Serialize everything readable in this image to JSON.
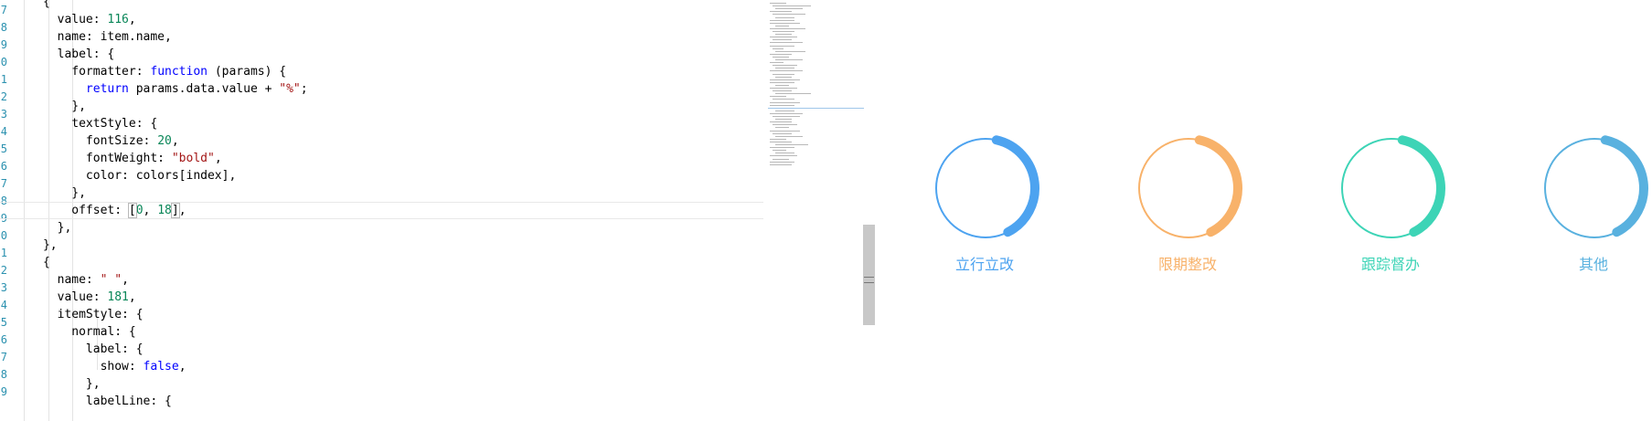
{
  "editor": {
    "gutter_numbers": [
      "7",
      "8",
      "9",
      "0",
      "1",
      "2",
      "3",
      "4",
      "5",
      "6",
      "7",
      "8",
      "9",
      "0",
      "1",
      "2",
      "3",
      "4",
      "5",
      "6",
      "7",
      "8",
      "9"
    ],
    "current_line_index": 12,
    "lines": [
      [
        {
          "t": "      {"
        }
      ],
      [
        {
          "t": "        value: "
        },
        {
          "t": "116",
          "c": "num"
        },
        {
          "t": ","
        }
      ],
      [
        {
          "t": "        name: item.name,"
        }
      ],
      [
        {
          "t": "        label: {"
        }
      ],
      [
        {
          "t": "          formatter: "
        },
        {
          "t": "function",
          "c": "kw"
        },
        {
          "t": " (params) {"
        }
      ],
      [
        {
          "t": "            "
        },
        {
          "t": "return",
          "c": "kw"
        },
        {
          "t": " params.data.value + "
        },
        {
          "t": "\"%\"",
          "c": "str"
        },
        {
          "t": ";"
        }
      ],
      [
        {
          "t": "          },"
        }
      ],
      [
        {
          "t": "          textStyle: {"
        }
      ],
      [
        {
          "t": "            fontSize: "
        },
        {
          "t": "20",
          "c": "num"
        },
        {
          "t": ","
        }
      ],
      [
        {
          "t": "            fontWeight: "
        },
        {
          "t": "\"bold\"",
          "c": "str"
        },
        {
          "t": ","
        }
      ],
      [
        {
          "t": "            color: colors[index],"
        }
      ],
      [
        {
          "t": "          },"
        }
      ],
      [
        {
          "t": "          offset: "
        },
        {
          "t": "[",
          "c": "caret"
        },
        {
          "t": "0",
          "c": "num"
        },
        {
          "t": ", "
        },
        {
          "t": "18",
          "c": "num"
        },
        {
          "t": "]",
          "c": "caret"
        },
        {
          "t": ","
        }
      ],
      [
        {
          "t": "        },"
        }
      ],
      [
        {
          "t": "      },"
        }
      ],
      [
        {
          "t": "      {"
        }
      ],
      [
        {
          "t": "        name: "
        },
        {
          "t": "\" \"",
          "c": "str"
        },
        {
          "t": ","
        }
      ],
      [
        {
          "t": "        value: "
        },
        {
          "t": "181",
          "c": "num"
        },
        {
          "t": ","
        }
      ],
      [
        {
          "t": "        itemStyle: {"
        }
      ],
      [
        {
          "t": "          normal: {"
        }
      ],
      [
        {
          "t": "            label: {"
        }
      ],
      [
        {
          "t": "              show: "
        },
        {
          "t": "false",
          "c": "kw"
        },
        {
          "t": ","
        }
      ],
      [
        {
          "t": "            },"
        }
      ],
      [
        {
          "t": "            labelLine: {"
        }
      ]
    ]
  },
  "gauges": [
    {
      "label": "立行立改",
      "color": "#4da3f0",
      "value": 116,
      "remainder": 181
    },
    {
      "label": "限期整改",
      "color": "#f8b26a",
      "value": 116,
      "remainder": 181
    },
    {
      "label": "跟踪督办",
      "color": "#3dd4b6",
      "value": 116,
      "remainder": 181
    },
    {
      "label": "其他",
      "color": "#59b1df",
      "value": 116,
      "remainder": 181
    }
  ],
  "colors": {
    "num": "#098658",
    "str": "#a31515",
    "kw": "#0000ff"
  }
}
